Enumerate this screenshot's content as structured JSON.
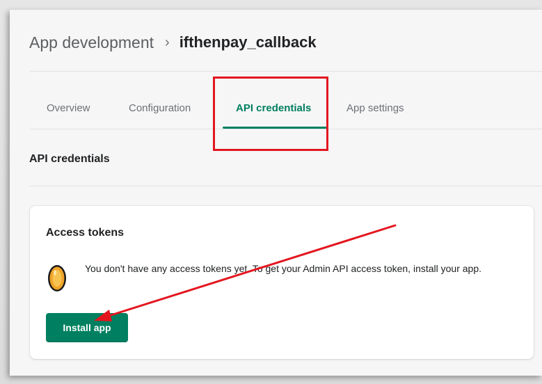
{
  "breadcrumb": {
    "parent": "App development",
    "separator": "›",
    "current": "ifthenpay_callback"
  },
  "tabs": [
    {
      "label": "Overview",
      "active": false
    },
    {
      "label": "Configuration",
      "active": false
    },
    {
      "label": "API credentials",
      "active": true
    },
    {
      "label": "App settings",
      "active": false
    }
  ],
  "section": {
    "title": "API credentials"
  },
  "access_tokens": {
    "title": "Access tokens",
    "icon": "coin-icon",
    "message": "You don't have any access tokens yet. To get your Admin API access token, install your app.",
    "install_label": "Install app"
  },
  "annotations": {
    "highlight_color": "#e3161f",
    "arrow_color": "#e3161f"
  },
  "colors": {
    "accent": "#008060",
    "active_tab_text": "#007f5f",
    "background": "#f6f6f7"
  }
}
